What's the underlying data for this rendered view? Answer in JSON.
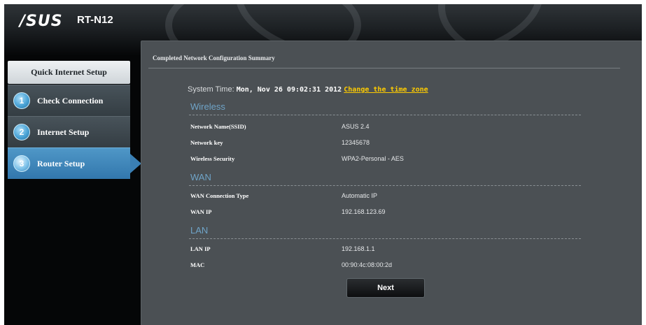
{
  "header": {
    "brand": "/SUS",
    "model": "RT-N12"
  },
  "sidebar": {
    "title": "Quick Internet Setup",
    "items": [
      {
        "number": "1",
        "label": "Check Connection",
        "active": false
      },
      {
        "number": "2",
        "label": "Internet Setup",
        "active": false
      },
      {
        "number": "3",
        "label": "Router Setup",
        "active": true
      }
    ]
  },
  "main": {
    "title": "Completed Network Configuration Summary",
    "system_time_label": "System Time:",
    "system_time_value": "Mon, Nov 26 09:02:31 2012",
    "change_time_zone": "Change the time zone",
    "wireless": {
      "heading": "Wireless",
      "ssid_label": "Network Name(SSID)",
      "ssid_value": "ASUS 2.4",
      "key_label": "Network key",
      "key_value": "12345678",
      "security_label": "Wireless Security",
      "security_value": "WPA2-Personal - AES"
    },
    "wan": {
      "heading": "WAN",
      "type_label": "WAN Connection Type",
      "type_value": "Automatic IP",
      "ip_label": "WAN IP",
      "ip_value": "192.168.123.69"
    },
    "lan": {
      "heading": "LAN",
      "ip_label": "LAN IP",
      "ip_value": "192.168.1.1",
      "mac_label": "MAC",
      "mac_value": "00:90:4c:08:00:2d"
    },
    "next_label": "Next"
  }
}
